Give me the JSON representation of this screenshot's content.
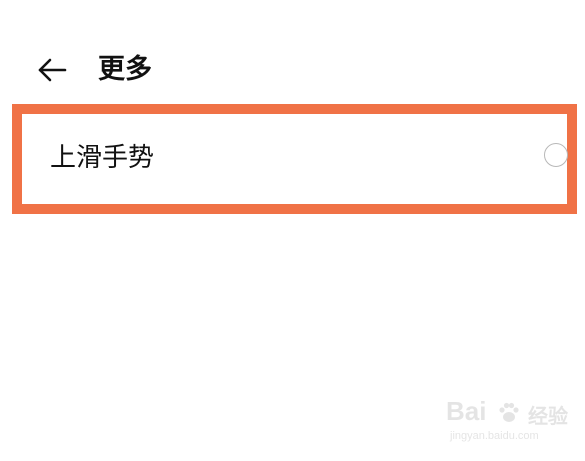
{
  "header": {
    "back_icon": "arrow-left-icon",
    "title": "更多"
  },
  "settings": {
    "items": [
      {
        "label": "上滑手势",
        "control": "radio",
        "selected": false
      }
    ]
  },
  "highlight_color": "#f07246",
  "watermark": {
    "brand": "Bai",
    "brand_cn": "经验",
    "url": "jingyan.baidu.com"
  }
}
